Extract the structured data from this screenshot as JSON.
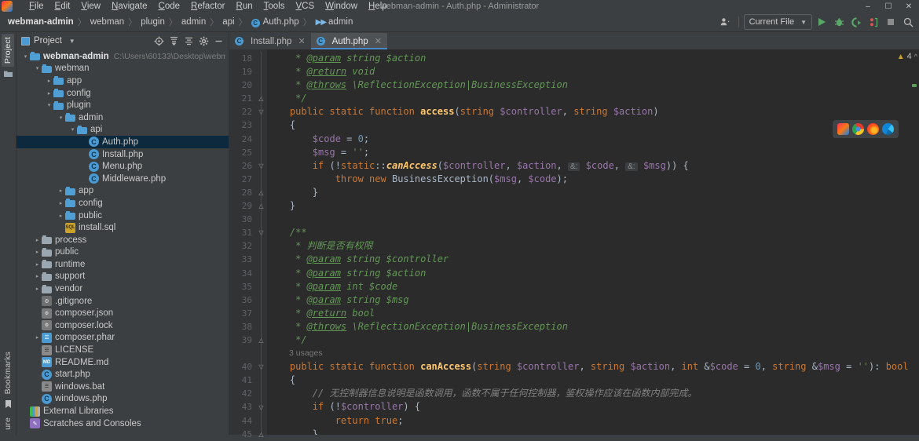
{
  "window": {
    "title": "webman-admin - Auth.php - Administrator",
    "minimize": "–",
    "maximize": "☐",
    "close": "✕",
    "logo_glyph": "IJ"
  },
  "menu": {
    "items": [
      "File",
      "Edit",
      "View",
      "Navigate",
      "Code",
      "Refactor",
      "Run",
      "Tools",
      "VCS",
      "Window",
      "Help"
    ]
  },
  "breadcrumb": {
    "items": [
      {
        "label": "webman-admin",
        "bold": true,
        "icon": ""
      },
      {
        "label": "webman",
        "bold": false,
        "icon": ""
      },
      {
        "label": "plugin",
        "bold": false,
        "icon": ""
      },
      {
        "label": "admin",
        "bold": false,
        "icon": ""
      },
      {
        "label": "api",
        "bold": false,
        "icon": ""
      },
      {
        "label": "Auth.php",
        "bold": false,
        "icon": "php-class-icon"
      },
      {
        "label": "admin",
        "bold": false,
        "icon": "run-anything-icon"
      }
    ],
    "separator": "〉"
  },
  "toolbar": {
    "account_icon": "user-account-icon",
    "run_config": "Current File",
    "run_icon": "run-icon",
    "debug_icon": "debug-icon",
    "coverage_icon": "run-with-coverage-icon",
    "profile_icon": "profiler-icon",
    "stop_icon": "stop-icon",
    "search_icon": "search-everywhere-icon"
  },
  "rail": {
    "top": [
      {
        "label": "Project",
        "active": true
      }
    ],
    "bottom": [
      {
        "label": "Bookmarks",
        "active": false
      },
      {
        "label": "ure",
        "active": false
      }
    ]
  },
  "project_panel": {
    "title": "Project",
    "icons": [
      "locate-icon",
      "expand-all-icon",
      "collapse-all-icon",
      "settings-gear-icon",
      "hide-icon"
    ],
    "tree": [
      {
        "depth": 0,
        "arrow": "open",
        "icon": "folder-blue",
        "label": "webman-admin",
        "bold": true,
        "path": "C:\\Users\\60133\\Desktop\\webm",
        "selected": false
      },
      {
        "depth": 1,
        "arrow": "open",
        "icon": "folder-blue",
        "label": "webman",
        "bold": false,
        "path": "",
        "selected": false
      },
      {
        "depth": 2,
        "arrow": "closed",
        "icon": "folder-blue",
        "label": "app",
        "bold": false,
        "path": "",
        "selected": false
      },
      {
        "depth": 2,
        "arrow": "closed",
        "icon": "folder-blue",
        "label": "config",
        "bold": false,
        "path": "",
        "selected": false
      },
      {
        "depth": 2,
        "arrow": "open",
        "icon": "folder-blue",
        "label": "plugin",
        "bold": false,
        "path": "",
        "selected": false
      },
      {
        "depth": 3,
        "arrow": "open",
        "icon": "folder-blue",
        "label": "admin",
        "bold": false,
        "path": "",
        "selected": false
      },
      {
        "depth": 4,
        "arrow": "open",
        "icon": "folder-blue",
        "label": "api",
        "bold": false,
        "path": "",
        "selected": false
      },
      {
        "depth": 5,
        "arrow": "none",
        "icon": "php",
        "label": "Auth.php",
        "bold": false,
        "path": "",
        "selected": true
      },
      {
        "depth": 5,
        "arrow": "none",
        "icon": "php",
        "label": "Install.php",
        "bold": false,
        "path": "",
        "selected": false
      },
      {
        "depth": 5,
        "arrow": "none",
        "icon": "php",
        "label": "Menu.php",
        "bold": false,
        "path": "",
        "selected": false
      },
      {
        "depth": 5,
        "arrow": "none",
        "icon": "php",
        "label": "Middleware.php",
        "bold": false,
        "path": "",
        "selected": false
      },
      {
        "depth": 3,
        "arrow": "closed",
        "icon": "folder-blue",
        "label": "app",
        "bold": false,
        "path": "",
        "selected": false
      },
      {
        "depth": 3,
        "arrow": "closed",
        "icon": "folder-blue",
        "label": "config",
        "bold": false,
        "path": "",
        "selected": false
      },
      {
        "depth": 3,
        "arrow": "closed",
        "icon": "folder-blue",
        "label": "public",
        "bold": false,
        "path": "",
        "selected": false
      },
      {
        "depth": 3,
        "arrow": "none",
        "icon": "sql",
        "label": "install.sql",
        "bold": false,
        "path": "",
        "selected": false
      },
      {
        "depth": 1,
        "arrow": "closed",
        "icon": "folder-grey",
        "label": "process",
        "bold": false,
        "path": "",
        "selected": false
      },
      {
        "depth": 1,
        "arrow": "closed",
        "icon": "folder-grey",
        "label": "public",
        "bold": false,
        "path": "",
        "selected": false
      },
      {
        "depth": 1,
        "arrow": "closed",
        "icon": "folder-grey",
        "label": "runtime",
        "bold": false,
        "path": "",
        "selected": false
      },
      {
        "depth": 1,
        "arrow": "closed",
        "icon": "folder-grey",
        "label": "support",
        "bold": false,
        "path": "",
        "selected": false
      },
      {
        "depth": 1,
        "arrow": "closed",
        "icon": "folder-grey",
        "label": "vendor",
        "bold": false,
        "path": "",
        "selected": false
      },
      {
        "depth": 1,
        "arrow": "none",
        "icon": "git",
        "label": ".gitignore",
        "bold": false,
        "path": "",
        "selected": false
      },
      {
        "depth": 1,
        "arrow": "none",
        "icon": "json",
        "label": "composer.json",
        "bold": false,
        "path": "",
        "selected": false
      },
      {
        "depth": 1,
        "arrow": "none",
        "icon": "json",
        "label": "composer.lock",
        "bold": false,
        "path": "",
        "selected": false
      },
      {
        "depth": 1,
        "arrow": "closed",
        "icon": "phar",
        "label": "composer.phar",
        "bold": false,
        "path": "",
        "selected": false
      },
      {
        "depth": 1,
        "arrow": "none",
        "icon": "txt",
        "label": "LICENSE",
        "bold": false,
        "path": "",
        "selected": false
      },
      {
        "depth": 1,
        "arrow": "none",
        "icon": "md",
        "label": "README.md",
        "bold": false,
        "path": "",
        "selected": false
      },
      {
        "depth": 1,
        "arrow": "none",
        "icon": "php",
        "label": "start.php",
        "bold": false,
        "path": "",
        "selected": false
      },
      {
        "depth": 1,
        "arrow": "none",
        "icon": "bat",
        "label": "windows.bat",
        "bold": false,
        "path": "",
        "selected": false
      },
      {
        "depth": 1,
        "arrow": "none",
        "icon": "php",
        "label": "windows.php",
        "bold": false,
        "path": "",
        "selected": false
      },
      {
        "depth": 0,
        "arrow": "none",
        "icon": "lib",
        "label": "External Libraries",
        "bold": false,
        "path": "",
        "selected": false
      },
      {
        "depth": 0,
        "arrow": "none",
        "icon": "scratch",
        "label": "Scratches and Consoles",
        "bold": false,
        "path": "",
        "selected": false
      }
    ]
  },
  "editor": {
    "tabs": [
      {
        "label": "Install.php",
        "active": false,
        "icon": "php-class-icon",
        "close": "✕"
      },
      {
        "label": "Auth.php",
        "active": true,
        "icon": "php-class-icon",
        "close": "✕"
      }
    ],
    "warning_count": "4",
    "warning_icon": "warning-triangle-icon",
    "chevron_icon": "chevron-up-icon",
    "browsers": [
      "intellij-browser-icon",
      "chrome-browser-icon",
      "firefox-browser-icon",
      "edge-browser-icon"
    ],
    "usages_label": "3 usages",
    "first_line": 18,
    "lines": [
      {
        "n": 18,
        "fold": "",
        "html": "     <span class='c-cm'>* </span><span class='c-tag'>@param</span><span class='c-cm'> string $action</span>"
      },
      {
        "n": 19,
        "fold": "",
        "html": "     <span class='c-cm'>* </span><span class='c-tag'>@return</span><span class='c-cm'> void</span>"
      },
      {
        "n": 20,
        "fold": "",
        "html": "     <span class='c-cm'>* </span><span class='c-tag'>@throws</span><span class='c-cm'> \\ReflectionException|BusinessException</span>"
      },
      {
        "n": 21,
        "fold": "end",
        "html": "     <span class='c-cm'>*/</span>"
      },
      {
        "n": 22,
        "fold": "start",
        "html": "    <span class='c-kw'>public static function</span> <span class='c-fn'>access</span>(<span class='c-kw'>string</span> <span class='c-var'>$controller</span>, <span class='c-kw'>string</span> <span class='c-var'>$action</span>)"
      },
      {
        "n": 23,
        "fold": "",
        "html": "    {"
      },
      {
        "n": 24,
        "fold": "",
        "html": "        <span class='c-var'>$code</span> = <span class='c-num'>0</span>;"
      },
      {
        "n": 25,
        "fold": "",
        "html": "        <span class='c-var'>$msg</span> = <span class='c-str'>''</span>;"
      },
      {
        "n": 26,
        "fold": "start",
        "html": "        <span class='c-kw'>if</span> (!<span class='c-kw'>static</span>::<span class='c-fni'>canAccess</span>(<span class='c-var'>$controller</span>, <span class='c-var'>$action</span>, <span class='hint'>&amp;:</span> <span class='c-var'>$code</span>, <span class='hint'>&amp;:</span> <span class='c-var'>$msg</span>)) {"
      },
      {
        "n": 27,
        "fold": "",
        "html": "            <span class='c-kw'>throw new</span> <span class='c-plain'>BusinessException</span>(<span class='c-var'>$msg</span>, <span class='c-var'>$code</span>);"
      },
      {
        "n": 28,
        "fold": "end",
        "html": "        }"
      },
      {
        "n": 29,
        "fold": "end",
        "html": "    }"
      },
      {
        "n": 30,
        "fold": "",
        "html": ""
      },
      {
        "n": 31,
        "fold": "start",
        "html": "    <span class='c-cm'>/**</span>"
      },
      {
        "n": 32,
        "fold": "",
        "html": "     <span class='c-cm'>* 判断是否有权限</span>"
      },
      {
        "n": 33,
        "fold": "",
        "html": "     <span class='c-cm'>* </span><span class='c-tag'>@param</span><span class='c-cm'> string $controller</span>"
      },
      {
        "n": 34,
        "fold": "",
        "html": "     <span class='c-cm'>* </span><span class='c-tag'>@param</span><span class='c-cm'> string $action</span>"
      },
      {
        "n": 35,
        "fold": "",
        "html": "     <span class='c-cm'>* </span><span class='c-tag'>@param</span><span class='c-cm'> int $code</span>"
      },
      {
        "n": 36,
        "fold": "",
        "html": "     <span class='c-cm'>* </span><span class='c-tag'>@param</span><span class='c-cm'> string $msg</span>"
      },
      {
        "n": 37,
        "fold": "",
        "html": "     <span class='c-cm'>* </span><span class='c-tag'>@return</span><span class='c-cm'> bool</span>"
      },
      {
        "n": 38,
        "fold": "",
        "html": "     <span class='c-cm'>* </span><span class='c-tag'>@throws</span><span class='c-cm'> \\ReflectionException|BusinessException</span>"
      },
      {
        "n": 39,
        "fold": "end",
        "html": "     <span class='c-cm'>*/</span>"
      },
      {
        "n": -1,
        "fold": "",
        "html": "__USAGES__"
      },
      {
        "n": 40,
        "fold": "start",
        "html": "    <span class='c-kw'>public static function</span> <span class='c-fn'>canAccess</span>(<span class='c-kw'>string</span> <span class='c-var'>$controller</span>, <span class='c-kw'>string</span> <span class='c-var'>$action</span>, <span class='c-kw'>int</span> &amp;<span class='c-var'>$code</span> = <span class='c-num'>0</span>, <span class='c-kw'>string</span> &amp;<span class='c-var'>$msg</span> = <span class='c-str'>''</span>): <span class='c-kw'>bool</span>"
      },
      {
        "n": 41,
        "fold": "",
        "html": "    {"
      },
      {
        "n": 42,
        "fold": "",
        "html": "        <span class='c-cmline'>// 无控制器信息说明是函数调用，函数不属于任何控制器，鉴权操作应该在函数内部完成。</span>"
      },
      {
        "n": 43,
        "fold": "start",
        "html": "        <span class='c-kw'>if</span> (!<span class='c-var'>$controller</span>) {"
      },
      {
        "n": 44,
        "fold": "",
        "html": "            <span class='c-kw'>return</span> <span class='c-kw'>true</span>;"
      },
      {
        "n": 45,
        "fold": "end",
        "html": "        }"
      }
    ]
  }
}
